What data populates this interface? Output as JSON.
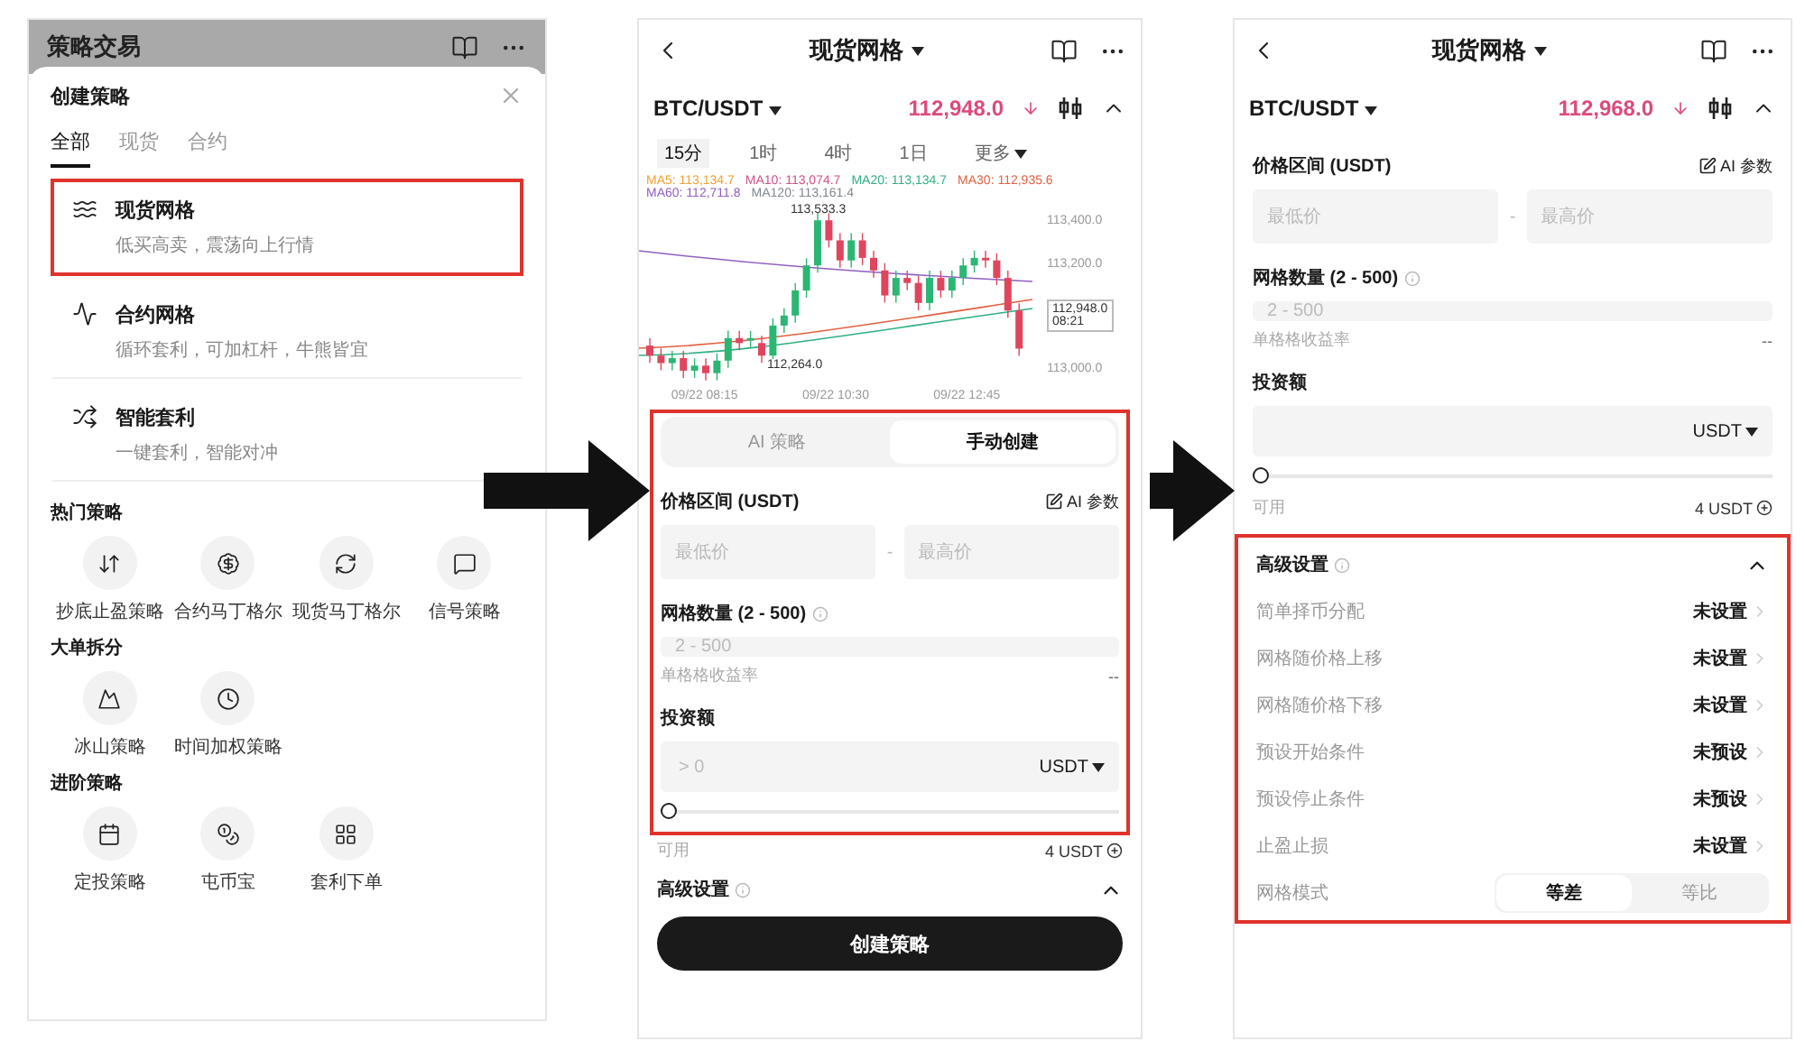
{
  "strategy_menu": {
    "title": "策略交易",
    "sheet_title": "创建策略",
    "tabs": [
      {
        "label": "全部",
        "selected": true
      },
      {
        "label": "现货",
        "selected": false
      },
      {
        "label": "合约",
        "selected": false
      }
    ],
    "items": [
      {
        "title": "现货网格",
        "subtitle": "低买高卖，震荡向上行情",
        "highlighted": true
      },
      {
        "title": "合约网格",
        "subtitle": "循环套利，可加杠杆，牛熊皆宜",
        "highlighted": false
      },
      {
        "title": "智能套利",
        "subtitle": "一键套利，智能对冲",
        "highlighted": false
      }
    ],
    "sections": [
      {
        "title": "热门策略",
        "items": [
          "抄底止盈策略",
          "合约马丁格尔",
          "现货马丁格尔",
          "信号策略"
        ]
      },
      {
        "title": "大单拆分",
        "items": [
          "冰山策略",
          "时间加权策略"
        ]
      },
      {
        "title": "进阶策略",
        "items": [
          "定投策略",
          "屯币宝",
          "套利下单"
        ]
      }
    ]
  },
  "grid_setup": {
    "title": "现货网格",
    "pair": "BTC/USDT",
    "price": "112,948.0",
    "intervals": [
      {
        "label": "15分",
        "selected": true
      },
      {
        "label": "1时",
        "selected": false
      },
      {
        "label": "4时",
        "selected": false
      },
      {
        "label": "1日",
        "selected": false
      },
      {
        "label": "更多",
        "selected": false
      }
    ],
    "ma_lines": [
      {
        "text": "MA5: 113,134.7",
        "color": "#f0a030"
      },
      {
        "text": "MA10: 113,074.7",
        "color": "#d0508a"
      },
      {
        "text": "MA20: 113,134.7",
        "color": "#30b080"
      },
      {
        "text": "MA30: 112,935.6",
        "color": "#e06040"
      },
      {
        "text": "MA60: 112,711.8",
        "color": "#9060c0"
      },
      {
        "text": "MA120: 113,161.4",
        "color": "#808890"
      }
    ],
    "chart": {
      "y_labels": [
        "113,400.0",
        "113,200.0",
        "113,000.0"
      ],
      "high_label": "113,533.3",
      "low_label": "112,264.0",
      "last_price": "112,948.0",
      "countdown": "08:21",
      "x_labels": [
        "09/22 08:15",
        "09/22 10:30",
        "09/22 12:45"
      ]
    },
    "form": {
      "highlighted": true,
      "modes": [
        {
          "label": "AI 策略",
          "selected": false
        },
        {
          "label": "手动创建",
          "selected": true
        }
      ],
      "price_range_label": "价格区间 (USDT)",
      "ai_params_label": "AI 参数",
      "min_placeholder": "最低价",
      "range_separator": "-",
      "max_placeholder": "最高价",
      "grid_count_label": "网格数量 (2 - 500)",
      "grid_count_placeholder": "2 - 500",
      "yield_label": "单格格收益率",
      "yield_value": "--",
      "investment_label": "投资额",
      "investment_placeholder": "> 0",
      "currency": "USDT",
      "level": 0
    },
    "available_label": "可用",
    "available_value": "4 USDT",
    "advanced": {
      "label": "高级设置",
      "expanded": true
    },
    "submit": "创建策略"
  },
  "grid_form": {
    "title": "现货网格",
    "pair": "BTC/USDT",
    "price": "112,968.0",
    "form": {
      "price_range_label": "价格区间 (USDT)",
      "ai_params_label": "AI 参数",
      "min_placeholder": "最低价",
      "range_separator": "-",
      "max_placeholder": "最高价",
      "grid_count_label": "网格数量 (2 - 500)",
      "grid_count_placeholder": "2 - 500",
      "yield_label": "单格格收益率",
      "yield_value": "--",
      "investment_label": "投资额",
      "currency": "USDT",
      "level": 0
    },
    "available_label": "可用",
    "available_value": "4 USDT",
    "advanced": {
      "label": "高级设置",
      "expanded": true,
      "highlighted": true,
      "rows": [
        {
          "label": "简单择币分配",
          "value": "未设置"
        },
        {
          "label": "网格随价格上移",
          "value": "未设置"
        },
        {
          "label": "网格随价格下移",
          "value": "未设置"
        },
        {
          "label": "预设开始条件",
          "value": "未预设"
        },
        {
          "label": "预设停止条件",
          "value": "未预设"
        },
        {
          "label": "止盈止损",
          "value": "未设置"
        }
      ],
      "mode_label": "网格模式",
      "modes": [
        {
          "label": "等差",
          "selected": true
        },
        {
          "label": "等比",
          "selected": false
        }
      ]
    }
  }
}
